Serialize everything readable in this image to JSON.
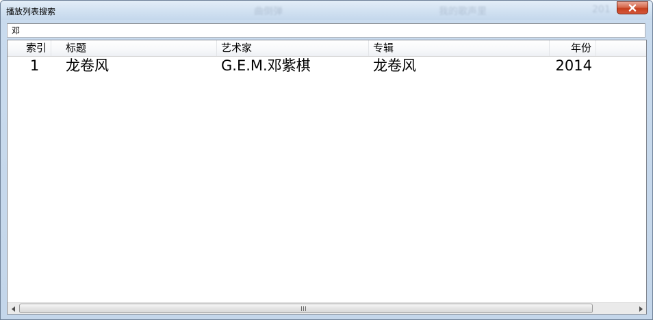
{
  "window": {
    "title": "播放列表搜索",
    "background_texts": [
      "曲倒弹",
      "我的歌声里",
      "201"
    ]
  },
  "search": {
    "value": "邓"
  },
  "table": {
    "columns": [
      {
        "key": "index",
        "label": "索引"
      },
      {
        "key": "title",
        "label": "标题"
      },
      {
        "key": "artist",
        "label": "艺术家"
      },
      {
        "key": "album",
        "label": "专辑"
      },
      {
        "key": "year",
        "label": "年份"
      }
    ],
    "rows": [
      {
        "index": "1",
        "title": "龙卷风",
        "artist": "G.E.M.邓紫棋",
        "album": "龙卷风",
        "year": "2014"
      }
    ]
  },
  "colors": {
    "title_bar": "#d3e2f2",
    "close_button": "#c6401f",
    "list_background": "#ffffff"
  },
  "icons": [
    "close-icon",
    "scroll-left-arrow-icon",
    "scroll-right-arrow-icon",
    "scrollbar-grip-icon"
  ]
}
